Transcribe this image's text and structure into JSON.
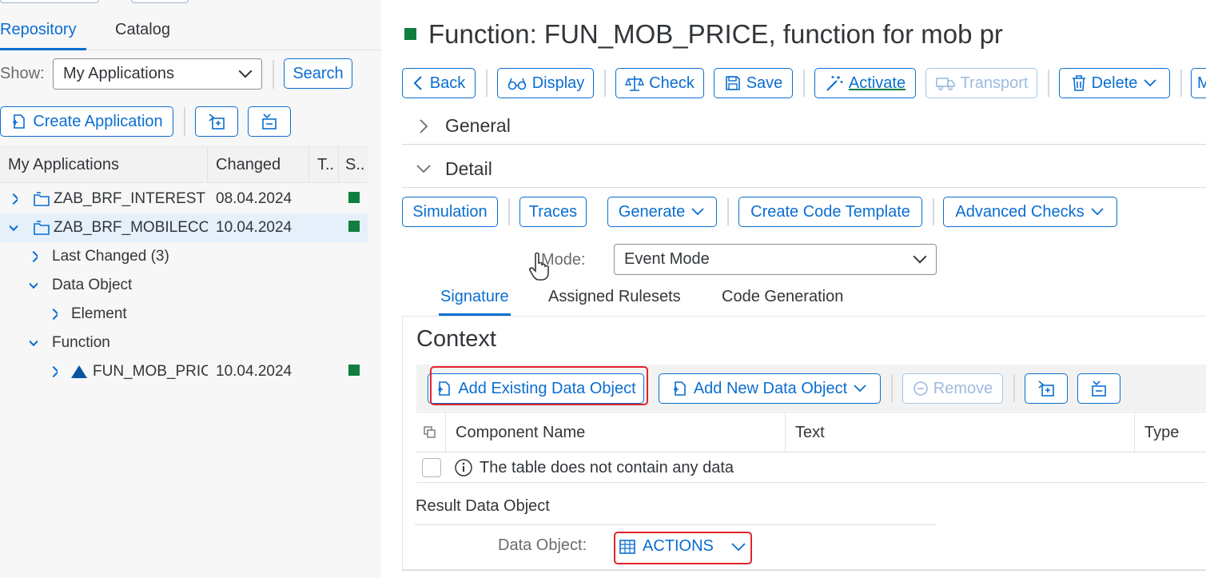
{
  "left": {
    "tabs": [
      {
        "label": "Repository",
        "active": true
      },
      {
        "label": "Catalog",
        "active": false
      }
    ],
    "show_label": "Show:",
    "show_select": "My Applications",
    "search_button": "Search",
    "create_button": "Create Application",
    "table": {
      "headers": [
        "My Applications",
        "Changed",
        "T..",
        "S.."
      ],
      "rows": [
        {
          "name": "ZAB_BRF_INTEREST",
          "changed": "08.04.2024"
        },
        {
          "name": "ZAB_BRF_MOBILECO",
          "changed": "10.04.2024"
        },
        {
          "name": "Last Changed (3)"
        },
        {
          "name": "Data Object"
        },
        {
          "name": "Element"
        },
        {
          "name": "Function"
        },
        {
          "name": "FUN_MOB_PRICE",
          "changed": "10.04.2024"
        }
      ]
    }
  },
  "right": {
    "title": "Function: FUN_MOB_PRICE, function for mob pr",
    "toolbar": {
      "back": "Back",
      "display": "Display",
      "check": "Check",
      "save": "Save",
      "activate": "Activate",
      "transport": "Transport",
      "delete": "Delete",
      "more": "M"
    },
    "sections": {
      "general": "General",
      "detail": "Detail"
    },
    "detail_toolbar": {
      "simulation": "Simulation",
      "traces": "Traces",
      "generate": "Generate",
      "create_code_template": "Create Code Template",
      "advanced_checks": "Advanced Checks"
    },
    "mode_label": "Mode:",
    "mode_value": "Event Mode",
    "tabs": [
      "Signature",
      "Assigned Rulesets",
      "Code Generation"
    ],
    "context": {
      "heading": "Context",
      "add_existing": "Add Existing Data Object",
      "add_new": "Add New Data Object",
      "remove": "Remove",
      "columns": [
        "Component Name",
        "Text",
        "Type"
      ],
      "empty_message": "The table does not contain any data"
    },
    "result": {
      "heading": "Result Data Object",
      "label": "Data Object:",
      "value": "ACTIONS"
    }
  },
  "colors": {
    "accent": "#0a6ed1",
    "status_green": "#107e3e",
    "highlight_red": "#e0242c"
  }
}
